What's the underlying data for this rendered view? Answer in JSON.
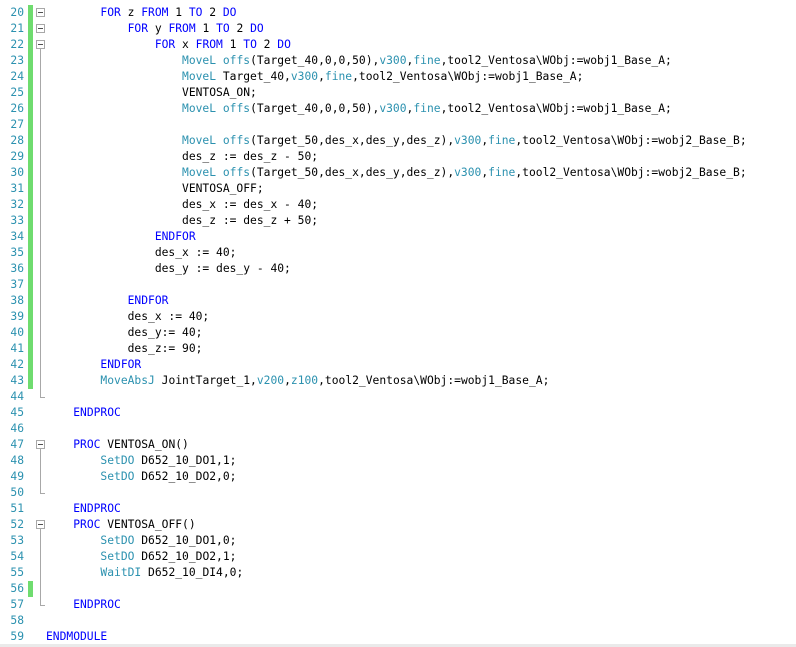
{
  "colors": {
    "keyword": "#0000ff",
    "function": "#2b91af",
    "text": "#000000",
    "line_number": "#2b91af",
    "modified_marker": "#6fdc6f",
    "fold_guide": "#a8a8a8"
  },
  "editor": {
    "lines": [
      {
        "n": "20",
        "mod": true,
        "fold": true,
        "tokens": [
          [
            "pl",
            "        "
          ],
          [
            "kw",
            "FOR"
          ],
          [
            "pl",
            " z "
          ],
          [
            "kw",
            "FROM"
          ],
          [
            "pl",
            " 1 "
          ],
          [
            "kw",
            "TO"
          ],
          [
            "pl",
            " 2 "
          ],
          [
            "kw",
            "DO"
          ]
        ]
      },
      {
        "n": "21",
        "mod": true,
        "fold": true,
        "tokens": [
          [
            "pl",
            "            "
          ],
          [
            "kw",
            "FOR"
          ],
          [
            "pl",
            " y "
          ],
          [
            "kw",
            "FROM"
          ],
          [
            "pl",
            " 1 "
          ],
          [
            "kw",
            "TO"
          ],
          [
            "pl",
            " 2 "
          ],
          [
            "kw",
            "DO"
          ]
        ]
      },
      {
        "n": "22",
        "mod": true,
        "fold": true,
        "tokens": [
          [
            "pl",
            "                "
          ],
          [
            "kw",
            "FOR"
          ],
          [
            "pl",
            " x "
          ],
          [
            "kw",
            "FROM"
          ],
          [
            "pl",
            " 1 "
          ],
          [
            "kw",
            "TO"
          ],
          [
            "pl",
            " 2 "
          ],
          [
            "kw",
            "DO"
          ]
        ]
      },
      {
        "n": "23",
        "mod": true,
        "fold": false,
        "tokens": [
          [
            "pl",
            "                    "
          ],
          [
            "fn",
            "MoveL"
          ],
          [
            "pl",
            " "
          ],
          [
            "fn",
            "offs"
          ],
          [
            "pl",
            "(Target_40,0,0,50),"
          ],
          [
            "fn",
            "v300"
          ],
          [
            "pl",
            ","
          ],
          [
            "fn",
            "fine"
          ],
          [
            "pl",
            ",tool2_Ventosa\\WObj:=wobj1_Base_A;"
          ]
        ]
      },
      {
        "n": "24",
        "mod": true,
        "fold": false,
        "tokens": [
          [
            "pl",
            "                    "
          ],
          [
            "fn",
            "MoveL"
          ],
          [
            "pl",
            " Target_40,"
          ],
          [
            "fn",
            "v300"
          ],
          [
            "pl",
            ","
          ],
          [
            "fn",
            "fine"
          ],
          [
            "pl",
            ",tool2_Ventosa\\WObj:=wobj1_Base_A;"
          ]
        ]
      },
      {
        "n": "25",
        "mod": true,
        "fold": false,
        "tokens": [
          [
            "pl",
            "                    VENTOSA_ON;"
          ]
        ]
      },
      {
        "n": "26",
        "mod": true,
        "fold": false,
        "tokens": [
          [
            "pl",
            "                    "
          ],
          [
            "fn",
            "MoveL"
          ],
          [
            "pl",
            " "
          ],
          [
            "fn",
            "offs"
          ],
          [
            "pl",
            "(Target_40,0,0,50),"
          ],
          [
            "fn",
            "v300"
          ],
          [
            "pl",
            ","
          ],
          [
            "fn",
            "fine"
          ],
          [
            "pl",
            ",tool2_Ventosa\\WObj:=wobj1_Base_A;"
          ]
        ]
      },
      {
        "n": "27",
        "mod": true,
        "fold": false,
        "tokens": []
      },
      {
        "n": "28",
        "mod": true,
        "fold": false,
        "tokens": [
          [
            "pl",
            "                    "
          ],
          [
            "fn",
            "MoveL"
          ],
          [
            "pl",
            " "
          ],
          [
            "fn",
            "offs"
          ],
          [
            "pl",
            "(Target_50,des_x,des_y,des_z),"
          ],
          [
            "fn",
            "v300"
          ],
          [
            "pl",
            ","
          ],
          [
            "fn",
            "fine"
          ],
          [
            "pl",
            ",tool2_Ventosa\\WObj:=wobj2_Base_B;"
          ]
        ]
      },
      {
        "n": "29",
        "mod": true,
        "fold": false,
        "tokens": [
          [
            "pl",
            "                    des_z := des_z - 50;"
          ]
        ]
      },
      {
        "n": "30",
        "mod": true,
        "fold": false,
        "tokens": [
          [
            "pl",
            "                    "
          ],
          [
            "fn",
            "MoveL"
          ],
          [
            "pl",
            " "
          ],
          [
            "fn",
            "offs"
          ],
          [
            "pl",
            "(Target_50,des_x,des_y,des_z),"
          ],
          [
            "fn",
            "v300"
          ],
          [
            "pl",
            ","
          ],
          [
            "fn",
            "fine"
          ],
          [
            "pl",
            ",tool2_Ventosa\\WObj:=wobj2_Base_B;"
          ]
        ]
      },
      {
        "n": "31",
        "mod": true,
        "fold": false,
        "tokens": [
          [
            "pl",
            "                    VENTOSA_OFF;"
          ]
        ]
      },
      {
        "n": "32",
        "mod": true,
        "fold": false,
        "tokens": [
          [
            "pl",
            "                    des_x := des_x - 40;"
          ]
        ]
      },
      {
        "n": "33",
        "mod": true,
        "fold": false,
        "tokens": [
          [
            "pl",
            "                    des_z := des_z + 50;"
          ]
        ]
      },
      {
        "n": "34",
        "mod": true,
        "fold": false,
        "tokens": [
          [
            "pl",
            "                "
          ],
          [
            "kw",
            "ENDFOR"
          ]
        ]
      },
      {
        "n": "35",
        "mod": true,
        "fold": false,
        "tokens": [
          [
            "pl",
            "                des_x := 40;"
          ]
        ]
      },
      {
        "n": "36",
        "mod": true,
        "fold": false,
        "tokens": [
          [
            "pl",
            "                des_y := des_y - 40;"
          ]
        ]
      },
      {
        "n": "37",
        "mod": true,
        "fold": false,
        "tokens": []
      },
      {
        "n": "38",
        "mod": true,
        "fold": false,
        "tokens": [
          [
            "pl",
            "            "
          ],
          [
            "kw",
            "ENDFOR"
          ]
        ]
      },
      {
        "n": "39",
        "mod": true,
        "fold": false,
        "tokens": [
          [
            "pl",
            "            des_x := 40;"
          ]
        ]
      },
      {
        "n": "40",
        "mod": true,
        "fold": false,
        "tokens": [
          [
            "pl",
            "            des_y:= 40;"
          ]
        ]
      },
      {
        "n": "41",
        "mod": true,
        "fold": false,
        "tokens": [
          [
            "pl",
            "            des_z:= 90;"
          ]
        ]
      },
      {
        "n": "42",
        "mod": true,
        "fold": false,
        "tokens": [
          [
            "pl",
            "        "
          ],
          [
            "kw",
            "ENDFOR"
          ]
        ]
      },
      {
        "n": "43",
        "mod": true,
        "fold": false,
        "tokens": [
          [
            "pl",
            "        "
          ],
          [
            "fn",
            "MoveAbsJ"
          ],
          [
            "pl",
            " JointTarget_1,"
          ],
          [
            "fn",
            "v200"
          ],
          [
            "pl",
            ","
          ],
          [
            "fn",
            "z100"
          ],
          [
            "pl",
            ",tool2_Ventosa\\WObj:=wobj1_Base_A;"
          ]
        ]
      },
      {
        "n": "44",
        "mod": false,
        "fold": false,
        "tokens": []
      },
      {
        "n": "45",
        "mod": false,
        "fold": false,
        "tokens": [
          [
            "pl",
            "    "
          ],
          [
            "kw",
            "ENDPROC"
          ]
        ]
      },
      {
        "n": "46",
        "mod": false,
        "fold": false,
        "tokens": []
      },
      {
        "n": "47",
        "mod": false,
        "fold": true,
        "tokens": [
          [
            "pl",
            "    "
          ],
          [
            "kw",
            "PROC"
          ],
          [
            "pl",
            " VENTOSA_ON()"
          ]
        ]
      },
      {
        "n": "48",
        "mod": false,
        "fold": false,
        "tokens": [
          [
            "pl",
            "        "
          ],
          [
            "fn",
            "SetDO"
          ],
          [
            "pl",
            " D652_10_DO1,1;"
          ]
        ]
      },
      {
        "n": "49",
        "mod": false,
        "fold": false,
        "tokens": [
          [
            "pl",
            "        "
          ],
          [
            "fn",
            "SetDO"
          ],
          [
            "pl",
            " D652_10_DO2,0;"
          ]
        ]
      },
      {
        "n": "50",
        "mod": false,
        "fold": false,
        "tokens": []
      },
      {
        "n": "51",
        "mod": false,
        "fold": false,
        "tokens": [
          [
            "pl",
            "    "
          ],
          [
            "kw",
            "ENDPROC"
          ]
        ]
      },
      {
        "n": "52",
        "mod": false,
        "fold": true,
        "tokens": [
          [
            "pl",
            "    "
          ],
          [
            "kw",
            "PROC"
          ],
          [
            "pl",
            " VENTOSA_OFF()"
          ]
        ]
      },
      {
        "n": "53",
        "mod": false,
        "fold": false,
        "tokens": [
          [
            "pl",
            "        "
          ],
          [
            "fn",
            "SetDO"
          ],
          [
            "pl",
            " D652_10_DO1,0;"
          ]
        ]
      },
      {
        "n": "54",
        "mod": false,
        "fold": false,
        "tokens": [
          [
            "pl",
            "        "
          ],
          [
            "fn",
            "SetDO"
          ],
          [
            "pl",
            " D652_10_DO2,1;"
          ]
        ]
      },
      {
        "n": "55",
        "mod": false,
        "fold": false,
        "tokens": [
          [
            "pl",
            "        "
          ],
          [
            "fn",
            "WaitDI"
          ],
          [
            "pl",
            " D652_10_DI4,0;"
          ]
        ]
      },
      {
        "n": "56",
        "mod": true,
        "fold": false,
        "tokens": []
      },
      {
        "n": "57",
        "mod": false,
        "fold": false,
        "tokens": [
          [
            "pl",
            "    "
          ],
          [
            "kw",
            "ENDPROC"
          ]
        ]
      },
      {
        "n": "58",
        "mod": false,
        "fold": false,
        "tokens": []
      },
      {
        "n": "59",
        "mod": false,
        "fold": false,
        "tokens": [
          [
            "kw",
            "ENDMODULE"
          ]
        ]
      }
    ]
  }
}
